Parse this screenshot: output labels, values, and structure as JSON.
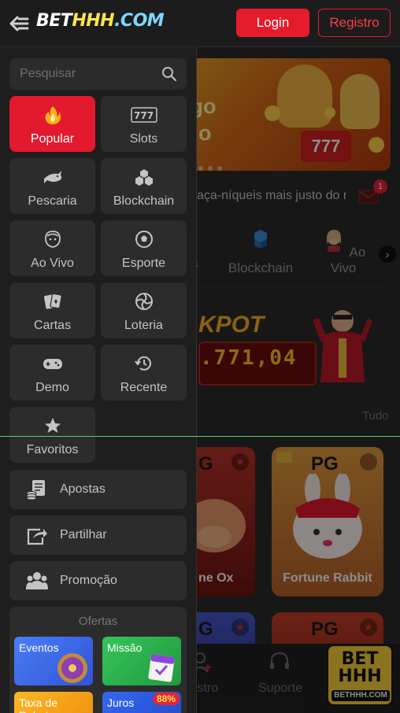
{
  "header": {
    "logo": {
      "bet": "BET",
      "hhh": "HHH",
      "com": ".COM"
    },
    "login_label": "Login",
    "register_label": "Registro"
  },
  "drawer": {
    "search_placeholder": "Pesquisar",
    "tiles": [
      {
        "label": "Popular",
        "icon": "flame-icon",
        "active": true
      },
      {
        "label": "Slots",
        "icon": "slot-777-icon"
      },
      {
        "label": "Pescaria",
        "icon": "shark-icon"
      },
      {
        "label": "Blockchain",
        "icon": "blockchain-cubes-icon"
      },
      {
        "label": "Ao Vivo",
        "icon": "live-dealer-icon"
      },
      {
        "label": "Esporte",
        "icon": "soccer-ball-icon"
      },
      {
        "label": "Cartas",
        "icon": "playing-cards-icon"
      },
      {
        "label": "Loteria",
        "icon": "lottery-icon"
      },
      {
        "label": "Demo",
        "icon": "gamepad-icon"
      },
      {
        "label": "Recente",
        "icon": "history-icon"
      },
      {
        "label": "Favoritos",
        "icon": "star-icon"
      }
    ],
    "rows": [
      {
        "label": "Apostas",
        "icon": "bets-icon"
      },
      {
        "label": "Partilhar",
        "icon": "share-icon"
      },
      {
        "label": "Promoção",
        "icon": "promotion-icon"
      }
    ],
    "offers": {
      "title": "Ofertas",
      "items": [
        {
          "label": "Eventos",
          "color": "#3d6cf0"
        },
        {
          "label": "Missão",
          "color": "#27b14b"
        },
        {
          "label": "Taxa de Rebate",
          "color": "#f4a10c"
        },
        {
          "label": "Juros",
          "color": "#2f62e8",
          "badge": "88%"
        }
      ]
    }
  },
  "main": {
    "banner_text_1": "igo",
    "banner_text_2": "rio",
    "marquee": "aça-níqueis mais justo do m",
    "mail_badge": "1",
    "categories": [
      "a",
      "Blockchain",
      "Ao Vivo"
    ],
    "jackpot_title": "KPOT",
    "jackpot_value": ".771,04",
    "view_all": "Tudo",
    "games": [
      {
        "name": "ne Ox",
        "provider": "G"
      },
      {
        "name": "Fortune Rabbit",
        "provider": "PG"
      },
      {
        "name": "",
        "provider": "G"
      },
      {
        "name": "",
        "provider": "PG"
      }
    ],
    "bottom_nav": [
      "gistro",
      "Suporte"
    ],
    "float_logo": {
      "line1": "BET",
      "line2": "HHH",
      "line3": "BETHHH.COM"
    }
  },
  "colors": {
    "accent": "#e3192e",
    "logo_yellow": "#ffe34d",
    "logo_blue": "#7fd6ff"
  }
}
